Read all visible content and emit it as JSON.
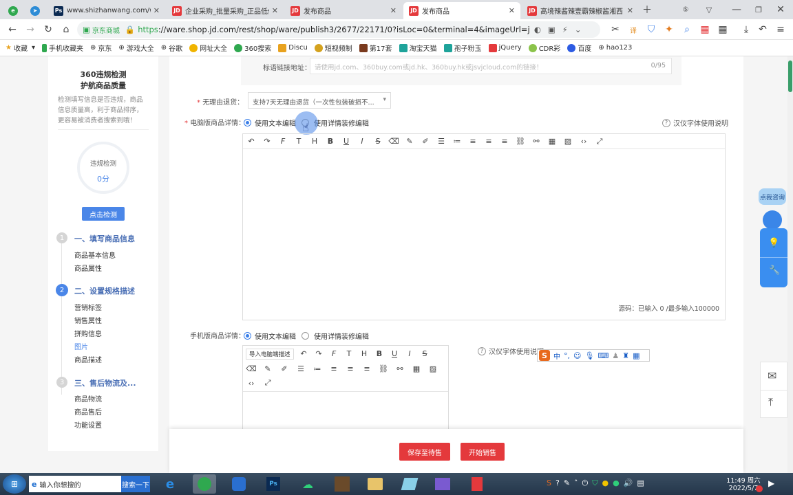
{
  "browser": {
    "tabs": [
      {
        "title": "",
        "icon": "ie-icon",
        "color": "#2fa84f"
      },
      {
        "title": "",
        "icon": "telegram-icon",
        "color": "#2d8cd6"
      },
      {
        "title": "www.shizhanwang.com/w",
        "icon": "ps-icon",
        "color": "#0b2a52"
      },
      {
        "title": "企业采购_批量采购_正品低价",
        "icon": "jd-icon",
        "color": "#e4393c"
      },
      {
        "title": "发布商品",
        "icon": "jd-icon",
        "color": "#e4393c"
      },
      {
        "title": "发布商品",
        "icon": "jd-icon",
        "color": "#e4393c"
      },
      {
        "title": "高境辣酱辣壹霸辣椒酱湘西",
        "icon": "jd-icon",
        "color": "#e4393c"
      }
    ],
    "site_label": "京东商城",
    "url_https": "https",
    "url_rest": "://ware.shop.jd.com/rest/shop/ware/publish3/2677/22171/0?isLoc=0&terminal=4&imageUrl=jfs",
    "bookmarks": [
      "收藏",
      "手机收藏夹",
      "京东",
      "游戏大全",
      "谷歌",
      "网址大全",
      "360搜索",
      "Discu",
      "短视频制",
      "第17套",
      "淘宝天猫",
      "孢子粉玉",
      "jQuery",
      "CDR彩",
      "百度",
      "hao123"
    ]
  },
  "sidebar": {
    "title_line1": "360违规检测",
    "title_line2": "护航商品质量",
    "desc": "检测填写信息是否违规，商品信息质量高，利于商品排序，更容易被消费者搜索到哦！",
    "circle_label": "违规检测",
    "circle_score": "0分",
    "check_button": "点击检测",
    "steps": [
      {
        "num": "1",
        "title": "一、填写商品信息",
        "items": [
          "商品基本信息",
          "商品属性"
        ]
      },
      {
        "num": "2",
        "title": "二、设置规格描述",
        "items": [
          "营销标签",
          "销售属性",
          "拼购信息",
          "图片",
          "商品描述"
        ]
      },
      {
        "num": "3",
        "title": "三、售后物流及...",
        "items": [
          "商品物流",
          "商品售后",
          "功能设置"
        ]
      }
    ]
  },
  "form": {
    "title_link_label": "标语链接地址：",
    "title_link_placeholder": "请使用jd.com、360buy.com或jd.hk、360buy.hk或jsvjcloud.com的链接！",
    "title_link_count": "0/95",
    "return_label": "无理由退货：",
    "return_value": "支持7天无理由退货（一次性包装破损不...",
    "pc_label": "电脑版商品详情：",
    "opt_text": "使用文本编辑",
    "opt_decor": "使用详情装修编辑",
    "font_help": "汉仪字体使用说明",
    "source_count": "源码：已输入 0 /最多输入100000",
    "mobile_label": "手机版商品详情：",
    "import_btn": "导入电脑端描述",
    "font_help_mobile": "汉仪字体使用说明",
    "ime_logo": "S",
    "ime_lang": "中"
  },
  "actions": {
    "save": "保存至待售",
    "sell": "开始销售"
  },
  "right_float": {
    "consult": "点我咨询"
  },
  "taskbar": {
    "search_placeholder": "输入你想搜的",
    "search_button": "搜索一下",
    "time": "11:49 周六",
    "date": "2022/5/7"
  }
}
